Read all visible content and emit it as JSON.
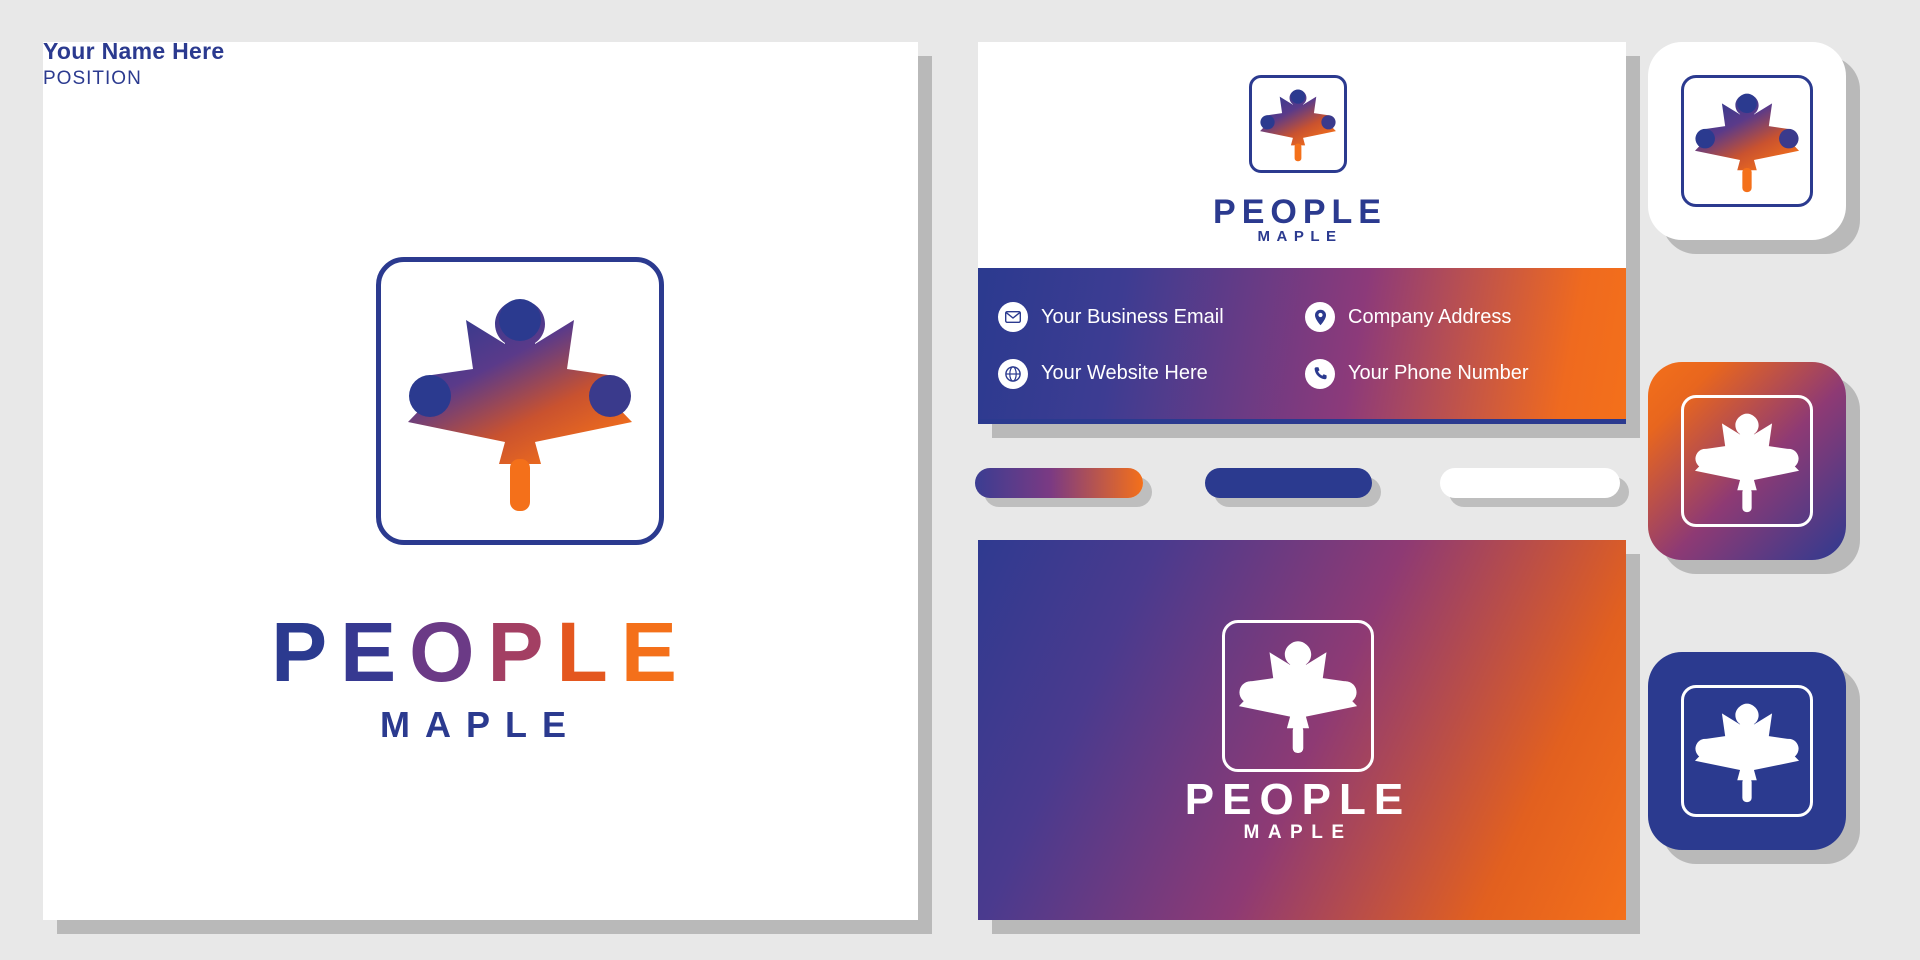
{
  "brand": {
    "name_main": "PEOPLE",
    "name_sub": "MAPLE",
    "letters_main": [
      "P",
      "E",
      "O",
      "P",
      "L",
      "E"
    ],
    "letter_colors": [
      "#2b3a8f",
      "#373991",
      "#6b3a86",
      "#a33f63",
      "#e4571f",
      "#f4701a"
    ],
    "colors": {
      "blue": "#2b3a8f",
      "orange": "#f4701a",
      "purple": "#8c3a7a",
      "white": "#ffffff",
      "background": "#e8e8e8",
      "shadow": "rgba(0,0,0,0.20)"
    }
  },
  "business_card_front": {
    "name": "Your Name Here",
    "position": "POSITION",
    "logo_word_main": "PEOPLE",
    "logo_word_sub": "MAPLE"
  },
  "contact_bar": {
    "items": [
      {
        "icon": "envelope-icon",
        "label": "Your Business Email"
      },
      {
        "icon": "location-pin-icon",
        "label": "Company Address"
      },
      {
        "icon": "globe-icon",
        "label": "Your Website Here"
      },
      {
        "icon": "phone-icon",
        "label": "Your Phone Number"
      }
    ]
  },
  "business_card_back": {
    "word_main": "PEOPLE",
    "word_sub": "MAPLE"
  },
  "icon_tiles": [
    {
      "name": "app-icon-white",
      "style": "white-background-gradient-leaf"
    },
    {
      "name": "app-icon-gradient",
      "style": "gradient-background-white-leaf"
    },
    {
      "name": "app-icon-blue",
      "style": "blue-background-white-leaf"
    }
  ],
  "swatch_pills": [
    {
      "name": "gradient-pill",
      "color": "gradient-blue-orange"
    },
    {
      "name": "blue-pill",
      "color": "#2b3a8f"
    },
    {
      "name": "white-pill",
      "color": "#ffffff"
    }
  ]
}
